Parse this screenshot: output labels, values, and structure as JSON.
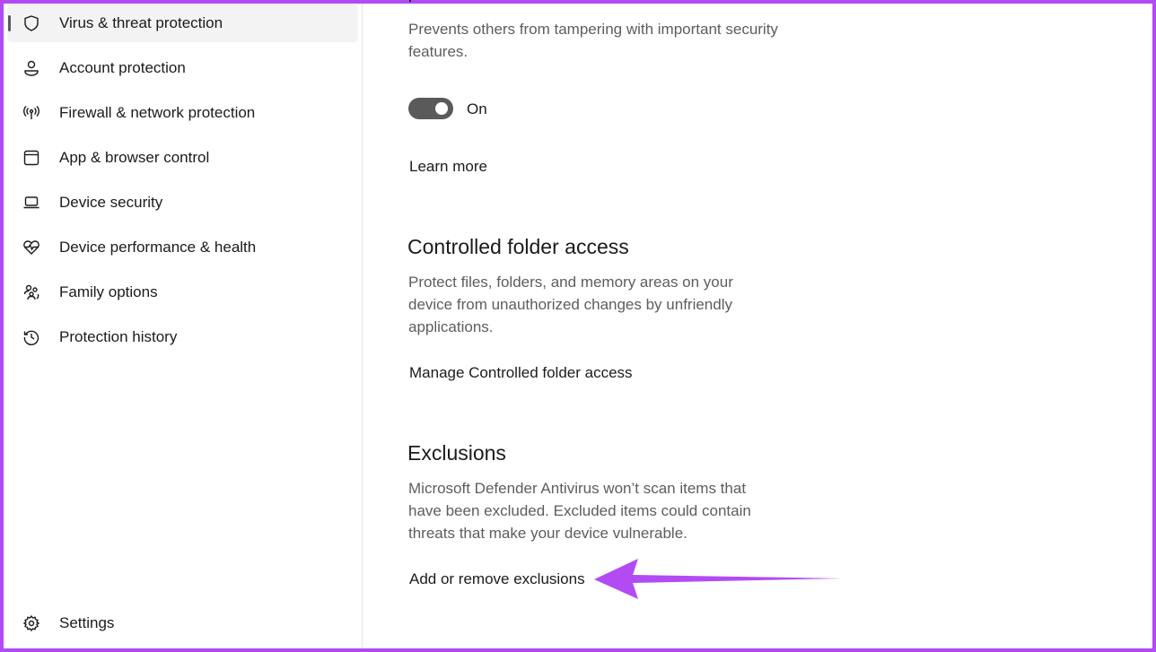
{
  "sidebar": {
    "items": [
      {
        "label": "Virus & threat protection",
        "icon": "shield-icon",
        "active": true
      },
      {
        "label": "Account protection",
        "icon": "person-icon"
      },
      {
        "label": "Firewall & network protection",
        "icon": "antenna-icon"
      },
      {
        "label": "App & browser control",
        "icon": "browser-window-icon"
      },
      {
        "label": "Device security",
        "icon": "laptop-icon"
      },
      {
        "label": "Device performance & health",
        "icon": "heart-pulse-icon"
      },
      {
        "label": "Family options",
        "icon": "family-icon"
      },
      {
        "label": "Protection history",
        "icon": "history-icon"
      }
    ],
    "settings": {
      "label": "Settings",
      "icon": "gear-icon"
    }
  },
  "main": {
    "tamper": {
      "description": "Prevents others from tampering with important security features.",
      "toggle_state": "On",
      "toggle_on": true,
      "learn_more": "Learn more"
    },
    "cfa": {
      "title": "Controlled folder access",
      "description": "Protect files, folders, and memory areas on your device from unauthorized changes by unfriendly applications.",
      "link": "Manage Controlled folder access"
    },
    "exclusions": {
      "title": "Exclusions",
      "description": "Microsoft Defender Antivirus won’t scan items that have been excluded. Excluded items could contain threats that make your device vulnerable.",
      "link": "Add or remove exclusions"
    }
  },
  "annotation": {
    "arrow_color": "#b24bf3"
  }
}
